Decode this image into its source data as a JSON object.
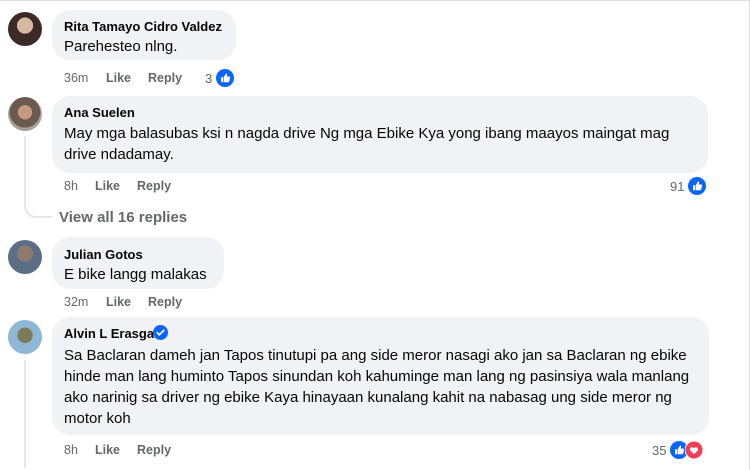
{
  "comments": [
    {
      "name": "Rita Tamayo Cidro Valdez",
      "text": "Parehesteo nlng.",
      "time": "36m",
      "like_label": "Like",
      "reply_label": "Reply",
      "reaction_count": "3"
    },
    {
      "name": "Ana Suelen",
      "text": "May mga balasubas ksi n nagda drive Ng mga Ebike Kya yong ibang maayos maingat mag drive ndadamay.",
      "time": "8h",
      "like_label": "Like",
      "reply_label": "Reply",
      "reaction_count": "91",
      "view_replies": "View all 16 replies"
    },
    {
      "name": "Julian Gotos",
      "text": "E bike langg malakas",
      "time": "32m",
      "like_label": "Like",
      "reply_label": "Reply"
    },
    {
      "name": "Alvin L Erasga",
      "verified": true,
      "text": "Sa Baclaran dameh jan Tapos tinutupi pa ang side meror nasagi ako jan sa Baclaran ng ebike hinde man lang huminto Tapos sinundan koh kahuminge man lang ng pasinsiya wala manlang ako narinig sa driver ng ebike Kaya hinayaan kunalang kahit na nabasag ung side meror ng motor koh",
      "time": "8h",
      "like_label": "Like",
      "reply_label": "Reply",
      "reaction_count": "35"
    }
  ],
  "colors": {
    "like_blue": "#0866ff",
    "love_red": "#f33e58",
    "bubble_bg": "#f0f2f5",
    "meta_gray": "#65676b",
    "verified_blue": "#0866ff"
  },
  "icons": [
    "like-reaction-icon",
    "love-reaction-icon",
    "verified-badge-icon"
  ]
}
